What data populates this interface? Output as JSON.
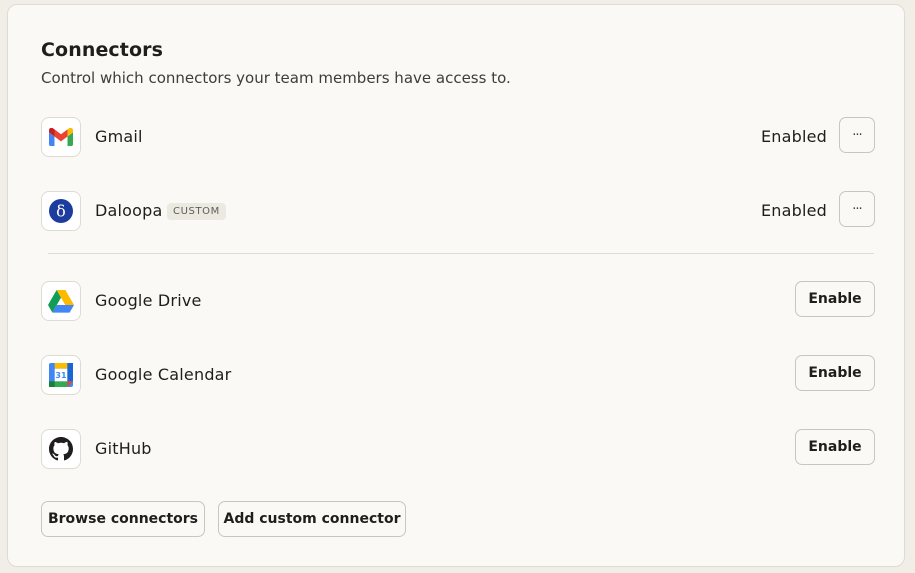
{
  "header": {
    "title": "Connectors",
    "subtitle": "Control which connectors your team members have access to."
  },
  "enabled_connectors": [
    {
      "name": "Gmail",
      "icon": "gmail-icon",
      "status": "Enabled",
      "more_label": "···"
    },
    {
      "name": "Daloopa",
      "icon": "daloopa-icon",
      "badge": "CUSTOM",
      "status": "Enabled",
      "more_label": "···"
    }
  ],
  "available_connectors": [
    {
      "name": "Google Drive",
      "icon": "google-drive-icon",
      "action_label": "Enable"
    },
    {
      "name": "Google Calendar",
      "icon": "google-calendar-icon",
      "calendar_day": "31",
      "action_label": "Enable"
    },
    {
      "name": "GitHub",
      "icon": "github-icon",
      "action_label": "Enable"
    }
  ],
  "footer": {
    "browse_label": "Browse connectors",
    "add_custom_label": "Add custom connector"
  },
  "colors": {
    "background": "#f0eee6",
    "panel": "#faf9f5",
    "border": "#dedcd1",
    "text": "#1f1e1d",
    "daloopa_blue": "#1c3d9e"
  }
}
